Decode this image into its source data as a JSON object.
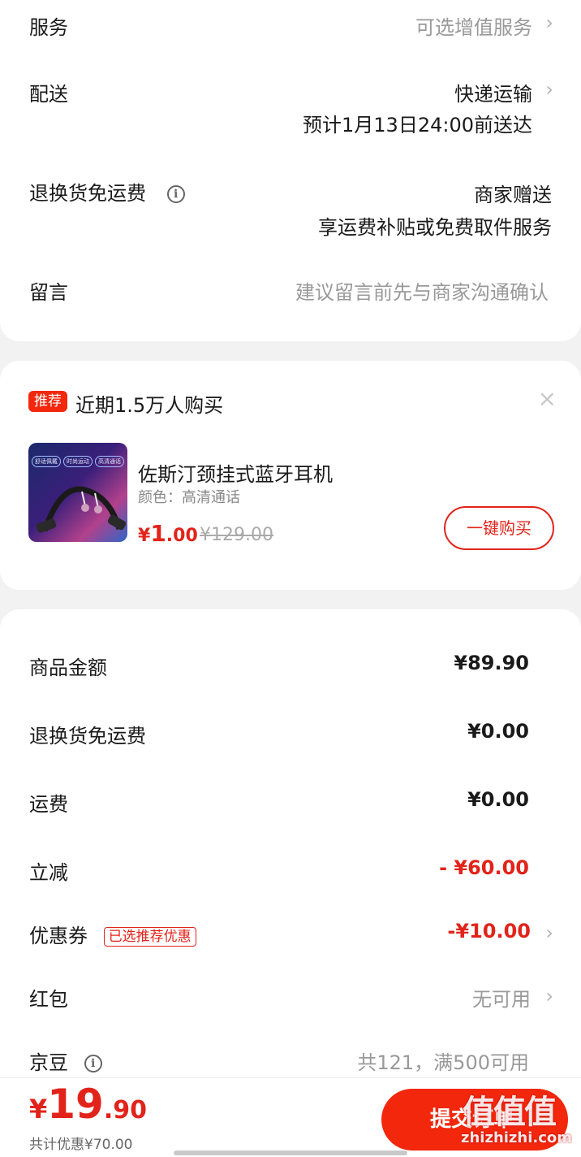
{
  "order_options": {
    "service": {
      "label": "服务",
      "value": "可选增值服务"
    },
    "delivery": {
      "label": "配送",
      "value": "快递运输",
      "eta": "预计1月13日24:00前送达"
    },
    "free_return": {
      "label": "退换货免运费",
      "value": "商家赠送",
      "detail": "享运费补贴或免费取件服务"
    },
    "message": {
      "label": "留言",
      "placeholder": "建议留言前先与商家沟通确认"
    }
  },
  "recommend": {
    "tag": "推荐",
    "title": "近期1.5万人购买",
    "close": "×",
    "thumb_chips": [
      "舒适佩戴",
      "时尚运动",
      "高清通话"
    ],
    "product": {
      "name": "佐斯汀颈挂式蓝牙耳机",
      "attr": "颜色：高清通话",
      "price_symbol": "¥",
      "price_int": "1",
      "price_dec": ".00",
      "original_price": "¥129.00",
      "buy_label": "一键购买"
    }
  },
  "price_summary": {
    "goods_amount": {
      "label": "商品金额",
      "value": "¥89.90"
    },
    "return_fee": {
      "label": "退换货免运费",
      "value": "¥0.00"
    },
    "shipping": {
      "label": "运费",
      "value": "¥0.00"
    },
    "discount": {
      "label": "立减",
      "value": "- ¥60.00"
    },
    "coupon": {
      "label": "优惠券",
      "tag": "已选推荐优惠",
      "value": "-¥10.00"
    },
    "red_packet": {
      "label": "红包",
      "value": "无可用"
    },
    "jd_beans": {
      "label": "京豆",
      "value": "共121，满500可用"
    }
  },
  "bottom_bar": {
    "currency": "¥",
    "total_int": "19",
    "total_dec": ".90",
    "savings": "共计优惠¥70.00",
    "submit_label": "提交订单"
  },
  "watermark": {
    "logo": "值值值",
    "url": "zhizhizhi.com"
  },
  "colors": {
    "accent": "#e2231a",
    "submit": "#f2270c",
    "background": "#f2f2f2"
  }
}
